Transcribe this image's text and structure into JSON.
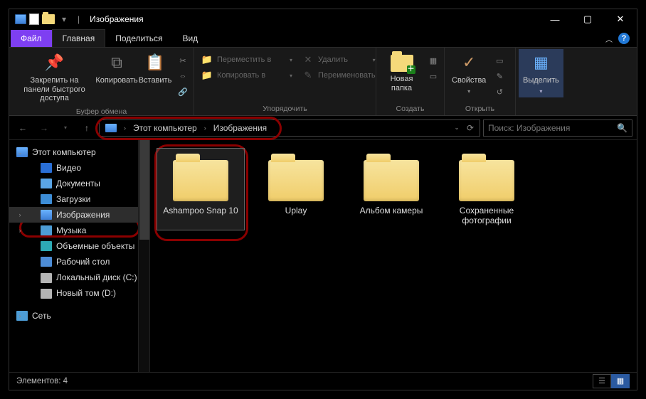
{
  "titlebar": {
    "title": "Изображения"
  },
  "tabs": {
    "file": "Файл",
    "main": "Главная",
    "share": "Поделиться",
    "view": "Вид"
  },
  "ribbon": {
    "clipboard": {
      "pin": "Закрепить на панели быстрого доступа",
      "copy": "Копировать",
      "paste": "Вставить",
      "label": "Буфер обмена"
    },
    "organize": {
      "move": "Переместить в",
      "copy_to": "Копировать в",
      "delete": "Удалить",
      "rename": "Переименовать",
      "label": "Упорядочить"
    },
    "create": {
      "new_folder": "Новая папка",
      "label": "Создать"
    },
    "open": {
      "properties": "Свойства",
      "label": "Открыть"
    },
    "select": {
      "select": "Выделить"
    }
  },
  "breadcrumb": {
    "root": "Этот компьютер",
    "current": "Изображения"
  },
  "search": {
    "placeholder": "Поиск: Изображения"
  },
  "sidebar": {
    "this_pc": "Этот компьютер",
    "video": "Видео",
    "documents": "Документы",
    "downloads": "Загрузки",
    "images": "Изображения",
    "music": "Музыка",
    "objects3d": "Объемные объекты",
    "desktop": "Рабочий стол",
    "drive_c": "Локальный диск (C:)",
    "drive_d": "Новый том (D:)",
    "network": "Сеть"
  },
  "folders": [
    {
      "name": "Ashampoo Snap 10",
      "selected": true
    },
    {
      "name": "Uplay",
      "selected": false
    },
    {
      "name": "Альбом камеры",
      "selected": false
    },
    {
      "name": "Сохраненные фотографии",
      "selected": false
    }
  ],
  "status": {
    "count_label": "Элементов: 4"
  }
}
